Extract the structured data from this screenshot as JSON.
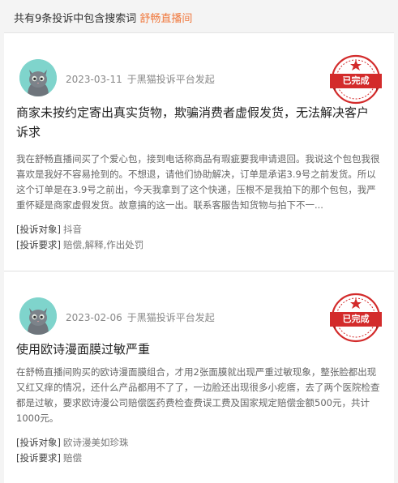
{
  "summary": {
    "prefix": "共有9条投诉中包含搜索词",
    "keyword": "舒畅直播间"
  },
  "complaints": [
    {
      "date": "2023-03-11",
      "source": "于黑猫投诉平台发起",
      "status": "已完成",
      "title": "商家未按约定寄出真实货物，欺骗消费者虚假发货，无法解决客户诉求",
      "body": "我在舒畅直播间买了个爱心包，接到电话称商品有瑕疵要我申请退回。我说这个包包我很喜欢是我好不容易抢到的。不想退，请他们协助解决，订单是承诺3.9号之前发货。所以这个订单是在3.9号之前出，今天我拿到了这个快递，压根不是我拍下的那个包包，我严重怀疑是商家虚假发货。故意搞的这一出。联系客服告知货物与拍下不一...",
      "target_label": "[投诉对象]",
      "target": "抖音",
      "demand_label": "[投诉要求]",
      "demand": "赔偿,解释,作出处罚"
    },
    {
      "date": "2023-02-06",
      "source": "于黑猫投诉平台发起",
      "status": "已完成",
      "title": "使用欧诗漫面膜过敏严重",
      "body": "在舒畅直播间购买的欧诗漫面膜组合，才用2张面膜就出现严重过敏现象，整张脸都出现又红又痒的情况，还什么产品都用不了了，一边脸还出现很多小疙瘩，去了两个医院检查都是过敏，要求欧诗漫公司赔偿医药费检查费误工费及国家规定赔偿金额500元，共计1000元。",
      "target_label": "[投诉对象]",
      "target": "欧诗漫美如珍珠",
      "demand_label": "[投诉要求]",
      "demand": "赔偿"
    }
  ],
  "colors": {
    "keyword": "#f0793e",
    "stamp": "#d32b2b",
    "avatar_bg": "#7fd4cc"
  },
  "icons": {
    "avatar": "gray-cat-avatar",
    "stamp": "completed-stamp-icon"
  }
}
